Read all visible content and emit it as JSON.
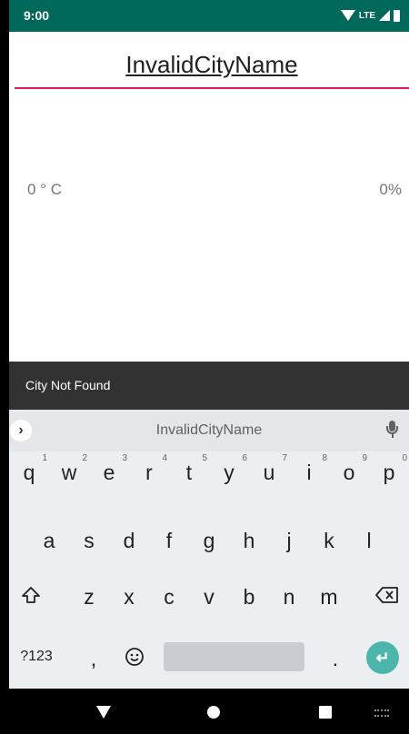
{
  "status_bar": {
    "time": "9:00",
    "network": "LTE"
  },
  "city_field": {
    "value": "InvalidCityName"
  },
  "weather": {
    "temperature": "0 ° C",
    "humidity": "0%"
  },
  "snackbar": {
    "message": "City Not Found"
  },
  "keyboard": {
    "suggestion": "InvalidCityName",
    "row1": [
      {
        "key": "q",
        "hint": "1"
      },
      {
        "key": "w",
        "hint": "2"
      },
      {
        "key": "e",
        "hint": "3"
      },
      {
        "key": "r",
        "hint": "4"
      },
      {
        "key": "t",
        "hint": "5"
      },
      {
        "key": "y",
        "hint": "6"
      },
      {
        "key": "u",
        "hint": "7"
      },
      {
        "key": "i",
        "hint": "8"
      },
      {
        "key": "o",
        "hint": "9"
      },
      {
        "key": "p",
        "hint": "0"
      }
    ],
    "row2": [
      "a",
      "s",
      "d",
      "f",
      "g",
      "h",
      "j",
      "k",
      "l"
    ],
    "row3": [
      "z",
      "x",
      "c",
      "v",
      "b",
      "n",
      "m"
    ],
    "symbols_label": "?123",
    "comma": ",",
    "period": ".",
    "accent_color": "#4DB6AC"
  },
  "colors": {
    "status_bar": "#00695C",
    "input_underline": "#D81B60",
    "snackbar": "#323232"
  }
}
